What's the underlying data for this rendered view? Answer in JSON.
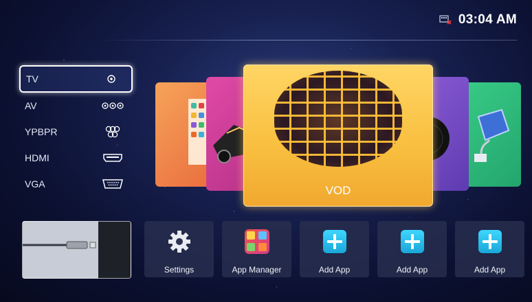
{
  "status": {
    "network_icon": "network-disconnected-icon",
    "clock": "03:04 AM"
  },
  "sources": [
    {
      "label": "TV",
      "icon": "antenna-connector-icon",
      "selected": true
    },
    {
      "label": "AV",
      "icon": "rca-connector-icon"
    },
    {
      "label": "YPBPR",
      "icon": "component-connector-icon"
    },
    {
      "label": "HDMI",
      "icon": "hdmi-port-icon"
    },
    {
      "label": "VGA",
      "icon": "vga-port-icon"
    }
  ],
  "carousel": {
    "focused_label": "VOD"
  },
  "tiles": [
    {
      "label": "Settings",
      "icon": "gear-icon"
    },
    {
      "label": "App Manager",
      "icon": "app-manager-icon"
    },
    {
      "label": "Add App",
      "icon": "add-app-icon"
    },
    {
      "label": "Add App",
      "icon": "add-app-icon"
    },
    {
      "label": "Add App",
      "icon": "add-app-icon"
    }
  ],
  "colors": {
    "focus_card": "#f8be3e",
    "add_app_icon": "#2fc1f0",
    "background": "#17204f"
  }
}
